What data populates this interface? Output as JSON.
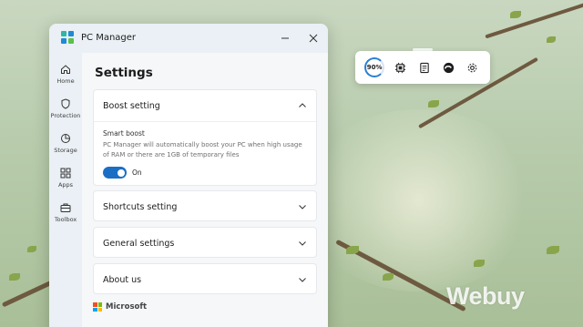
{
  "window": {
    "app_title": "PC Manager",
    "page_title": "Settings"
  },
  "sidebar": {
    "items": [
      {
        "label": "Home",
        "icon": "home-icon"
      },
      {
        "label": "Protection",
        "icon": "shield-icon"
      },
      {
        "label": "Storage",
        "icon": "pie-chart-icon"
      },
      {
        "label": "Apps",
        "icon": "apps-grid-icon"
      },
      {
        "label": "Toolbox",
        "icon": "toolbox-icon"
      }
    ]
  },
  "sections": {
    "boost": {
      "title": "Boost setting",
      "expanded": true,
      "option_name": "Smart boost",
      "option_desc": "PC Manager will automatically boost your PC when high usage of RAM or there are 1GB of temporary files",
      "toggle_state": "On",
      "toggle_on": true
    },
    "shortcuts": {
      "title": "Shortcuts setting",
      "expanded": false
    },
    "general": {
      "title": "General settings",
      "expanded": false
    },
    "about": {
      "title": "About us",
      "expanded": false
    }
  },
  "footer": {
    "brand": "Microsoft"
  },
  "widget": {
    "boost_percent": "90%",
    "buttons": [
      "memory-chip-icon",
      "notes-icon",
      "edge-browser-icon",
      "gear-icon"
    ]
  },
  "watermark": "Webuy",
  "colors": {
    "accent": "#1a6fc4",
    "ring": "#2a7fd6"
  }
}
